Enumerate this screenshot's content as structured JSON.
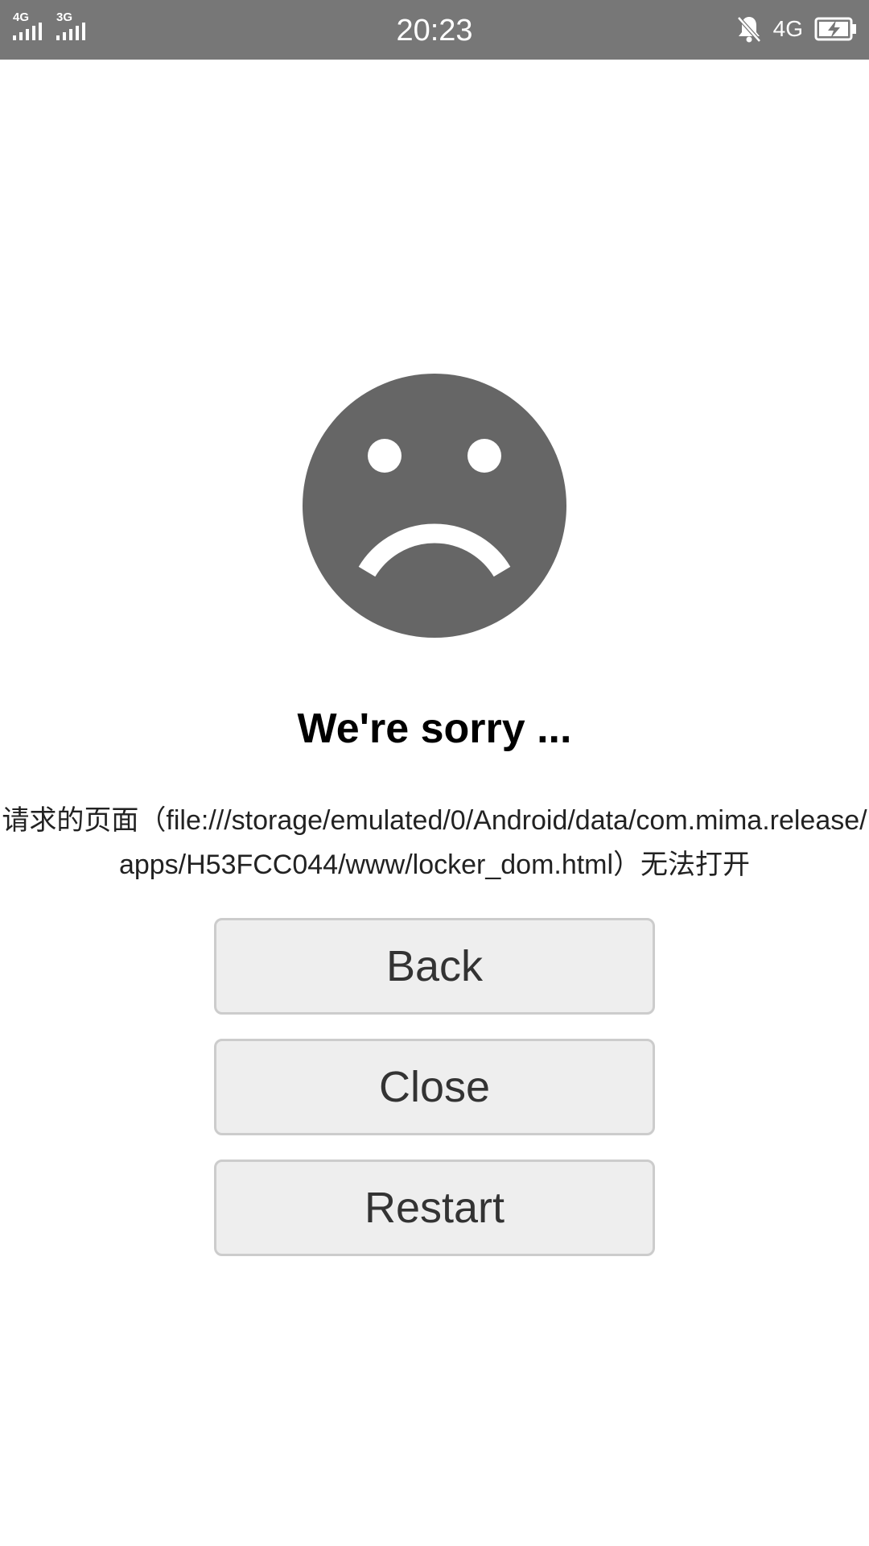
{
  "status_bar": {
    "sim1_network": "4G",
    "sim2_network": "3G",
    "time": "20:23",
    "right_network": "4G",
    "icons": [
      "signal-icon",
      "signal-icon",
      "bell-off-icon",
      "battery-charging-icon"
    ]
  },
  "error_page": {
    "icon": "sad-face-icon",
    "title": "We're sorry ...",
    "message": "请求的页面（file:///storage/emulated/0/Android/data/com.mima.release/apps/H53FCC044/www/locker_dom.html）无法打开",
    "buttons": {
      "back": "Back",
      "close": "Close",
      "restart": "Restart"
    }
  },
  "colors": {
    "status_bar_bg": "#777777",
    "face_fill": "#666666",
    "button_bg": "#eeeeee",
    "button_border": "#cccccc"
  }
}
